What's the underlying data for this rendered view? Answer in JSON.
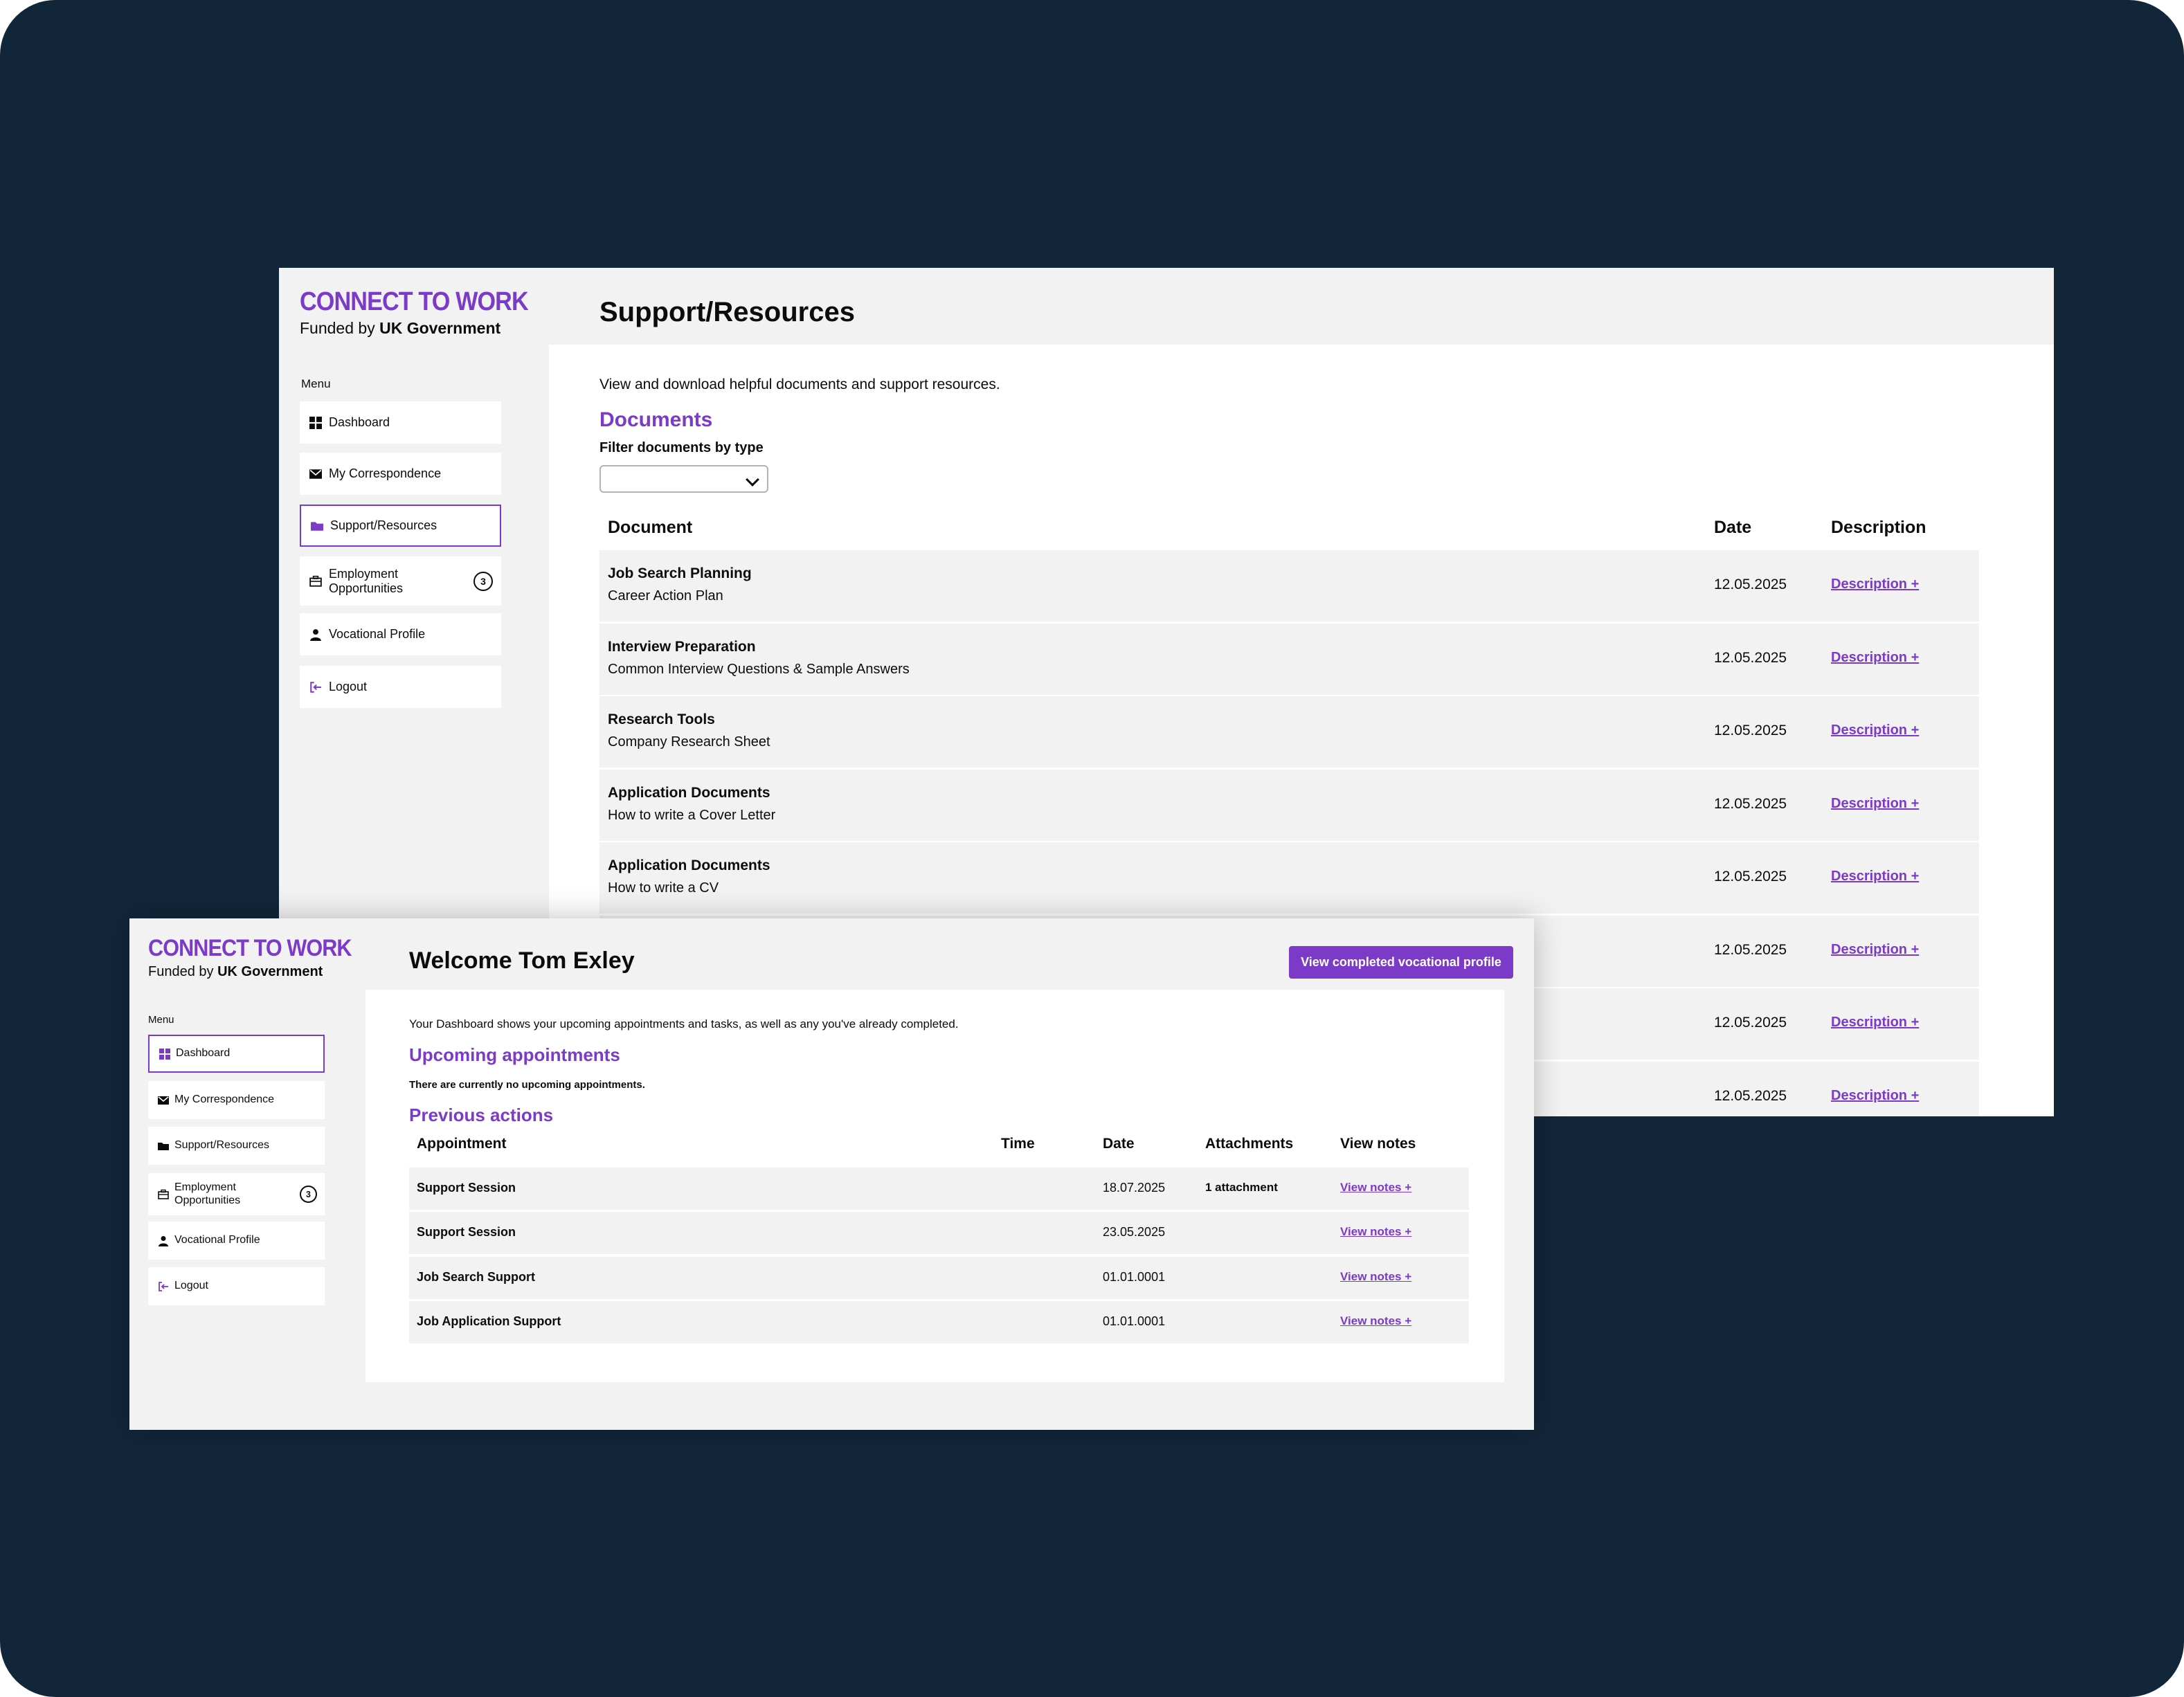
{
  "colors": {
    "background": "#12263a",
    "brand_purple": "#7c3ac8",
    "panel": "#f2f2f2"
  },
  "back_window": {
    "logo_title": "CONNECT TO WORK",
    "logo_funded": "Funded by",
    "logo_gov": "UK Government",
    "menu_label": "Menu",
    "nav": [
      {
        "label": "Dashboard",
        "icon": "dashboard-grid-icon"
      },
      {
        "label": "My Correspondence",
        "icon": "envelope-icon"
      },
      {
        "label": "Support/Resources",
        "icon": "folder-icon",
        "active": true
      },
      {
        "label": "Employment Opportunities",
        "icon": "briefcase-icon",
        "badge": "3"
      },
      {
        "label": "Vocational Profile",
        "icon": "person-icon"
      },
      {
        "label": "Logout",
        "icon": "logout-icon"
      }
    ],
    "page_title": "Support/Resources",
    "intro": "View and download helpful documents and support resources.",
    "documents_heading": "Documents",
    "filter_label": "Filter documents by type",
    "filter_value": "",
    "table_headers": {
      "document": "Document",
      "date": "Date",
      "description": "Description"
    },
    "rows": [
      {
        "title": "Job Search Planning",
        "subtitle": "Career Action Plan",
        "date": "12.05.2025",
        "link": "Description +"
      },
      {
        "title": "Interview Preparation",
        "subtitle": "Common Interview Questions & Sample Answers",
        "date": "12.05.2025",
        "link": "Description +"
      },
      {
        "title": "Research Tools",
        "subtitle": "Company Research Sheet",
        "date": "12.05.2025",
        "link": "Description +"
      },
      {
        "title": "Application Documents",
        "subtitle": "How to write a Cover Letter",
        "date": "12.05.2025",
        "link": "Description +"
      },
      {
        "title": "Application Documents",
        "subtitle": "How to write a CV",
        "date": "12.05.2025",
        "link": "Description +"
      },
      {
        "title": "",
        "subtitle": "",
        "date": "12.05.2025",
        "link": "Description +"
      },
      {
        "title": "",
        "subtitle": "",
        "date": "12.05.2025",
        "link": "Description +"
      },
      {
        "title": "",
        "subtitle": "",
        "date": "12.05.2025",
        "link": "Description +"
      }
    ]
  },
  "front_window": {
    "logo_title": "CONNECT TO WORK",
    "logo_funded": "Funded by",
    "logo_gov": "UK Government",
    "menu_label": "Menu",
    "nav": [
      {
        "label": "Dashboard",
        "icon": "dashboard-grid-icon",
        "active": true
      },
      {
        "label": "My Correspondence",
        "icon": "envelope-icon"
      },
      {
        "label": "Support/Resources",
        "icon": "folder-icon"
      },
      {
        "label": "Employment Opportunities",
        "icon": "briefcase-icon",
        "badge": "3"
      },
      {
        "label": "Vocational Profile",
        "icon": "person-icon"
      },
      {
        "label": "Logout",
        "icon": "logout-icon"
      }
    ],
    "welcome": "Welcome Tom Exley",
    "vocational_button": "View completed vocational profile",
    "intro": "Your Dashboard shows your upcoming appointments and tasks, as well as any you've already completed.",
    "upcoming_heading": "Upcoming appointments",
    "no_upcoming": "There are currently no upcoming appointments.",
    "previous_heading": "Previous actions",
    "table_headers": {
      "appointment": "Appointment",
      "time": "Time",
      "date": "Date",
      "attachments": "Attachments",
      "notes": "View notes"
    },
    "rows": [
      {
        "appointment": "Support Session",
        "time": "",
        "date": "18.07.2025",
        "attachments": "1 attachment",
        "notes": "View notes +"
      },
      {
        "appointment": "Support Session",
        "time": "",
        "date": "23.05.2025",
        "attachments": "",
        "notes": "View notes +"
      },
      {
        "appointment": "Job Search Support",
        "time": "",
        "date": "01.01.0001",
        "attachments": "",
        "notes": "View notes +"
      },
      {
        "appointment": "Job Application Support",
        "time": "",
        "date": "01.01.0001",
        "attachments": "",
        "notes": "View notes +"
      }
    ]
  }
}
